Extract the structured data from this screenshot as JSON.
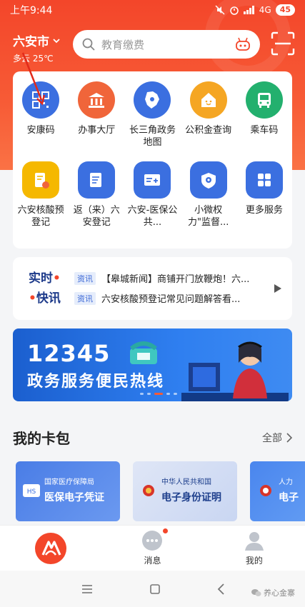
{
  "status": {
    "time": "上午9:44",
    "network": "4G",
    "battery": "45"
  },
  "header": {
    "city": "六安市",
    "weather": "多云 25℃"
  },
  "search": {
    "placeholder": "教育缴费"
  },
  "services": [
    {
      "label": "安康码",
      "icon": "qr-code-icon",
      "color": "#3b6fe0"
    },
    {
      "label": "办事大厅",
      "icon": "government-building-icon",
      "color": "#f0653a"
    },
    {
      "label": "长三角政务地图",
      "icon": "map-region-icon",
      "color": "#3b6fe0"
    },
    {
      "label": "公积金查询",
      "icon": "house-icon",
      "color": "#f5a623"
    },
    {
      "label": "乘车码",
      "icon": "bus-icon",
      "color": "#23b06e"
    },
    {
      "label": "六安核酸预登记",
      "icon": "test-tube-icon",
      "color": "#f5b800"
    },
    {
      "label": "返（来）六安登记",
      "icon": "register-form-icon",
      "color": "#3b6fe0"
    },
    {
      "label": "六安-医保公共...",
      "icon": "medical-card-icon",
      "color": "#3b6fe0"
    },
    {
      "label": "小微权力\"监督...",
      "icon": "supervision-eye-icon",
      "color": "#3b6fe0"
    },
    {
      "label": "更多服务",
      "icon": "grid-more-icon",
      "color": "#3b6fe0"
    }
  ],
  "news": {
    "logo_top": "实时",
    "logo_bottom": "快讯",
    "items": [
      {
        "tag": "资讯",
        "text": "【皋城新闻】商铺开门放鞭炮！六..."
      },
      {
        "tag": "资讯",
        "text": "六安核酸预登记常见问题解答看..."
      }
    ]
  },
  "banner": {
    "number": "12345",
    "title": "政务服务便民热线"
  },
  "wallet": {
    "title": "我的卡包",
    "more": "全部",
    "cards": [
      {
        "org": "国家医疗保障局",
        "name": "医保电子凭证"
      },
      {
        "org": "中华人民共和国",
        "name": "电子身份证明"
      },
      {
        "org": "人力",
        "name": "电子"
      }
    ]
  },
  "tabs": [
    {
      "label": ""
    },
    {
      "label": "消息"
    },
    {
      "label": "我的"
    }
  ],
  "watermark": "养心金寨",
  "colors": {
    "brand": "#f3462a",
    "blue": "#3b6fe0"
  }
}
